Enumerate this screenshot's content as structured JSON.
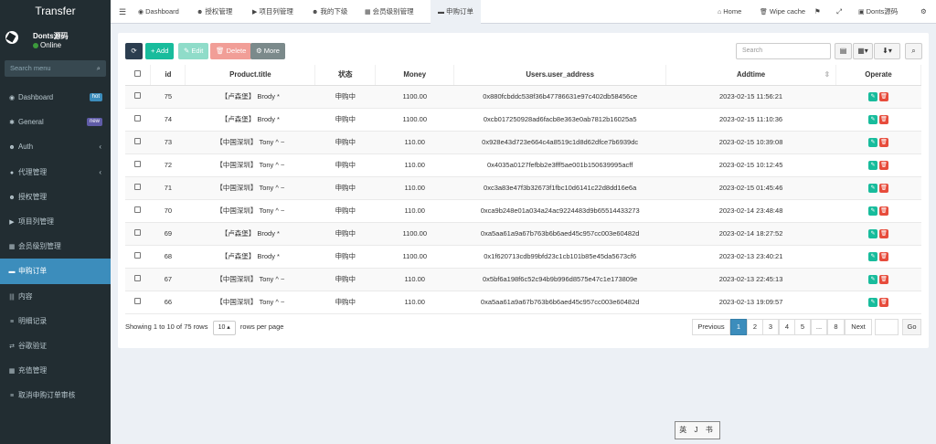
{
  "app": {
    "title": "Transfer"
  },
  "user": {
    "name": "Donts源码",
    "status": "Online"
  },
  "search": {
    "placeholder": "Search menu"
  },
  "menu": [
    {
      "icon": "dashboard-icon",
      "glyph": "◉",
      "label": "Dashboard",
      "badge": "hot",
      "badge_color": "#3c8dbc"
    },
    {
      "icon": "cogs-icon",
      "glyph": "✱",
      "label": "General",
      "badge": "new",
      "badge_color": "#605ca8"
    },
    {
      "icon": "users-icon",
      "glyph": "☻",
      "label": "Auth",
      "arrow": "‹"
    },
    {
      "icon": "user-circle-icon",
      "glyph": "●",
      "label": "代理管理",
      "arrow": "‹"
    },
    {
      "icon": "users-icon",
      "glyph": "☻",
      "label": "授权管理"
    },
    {
      "icon": "play-circle-icon",
      "glyph": "▶",
      "label": "项目列管理"
    },
    {
      "icon": "calendar-icon",
      "glyph": "▦",
      "label": "会员级别管理"
    },
    {
      "icon": "credit-card-icon",
      "glyph": "▬",
      "label": "申购订单",
      "active": true
    },
    {
      "icon": "barcode-icon",
      "glyph": "|||",
      "label": "内容"
    },
    {
      "icon": "list-icon",
      "glyph": "≡",
      "label": "明细记录"
    },
    {
      "icon": "exchange-icon",
      "glyph": "⇄",
      "label": "谷歌验证"
    },
    {
      "icon": "calendar-check-icon",
      "glyph": "▦",
      "label": "充值管理"
    },
    {
      "icon": "list-icon",
      "glyph": "≡",
      "label": "取消申购订单审核"
    }
  ],
  "topbar": {
    "menu_glyph": "☰",
    "tabs": [
      {
        "label": "Dashboard",
        "glyph": "◉"
      },
      {
        "label": "授权管理",
        "glyph": "☻"
      },
      {
        "label": "项目列管理",
        "glyph": "▶"
      },
      {
        "label": "我的下级",
        "glyph": "☻"
      },
      {
        "label": "会员级别管理",
        "glyph": "▦"
      },
      {
        "label": "申购订单",
        "glyph": "▬",
        "active": true
      }
    ],
    "home": "Home",
    "wipe": "Wipe cache",
    "user": "Donts源码"
  },
  "toolbar": {
    "refresh": "⟳",
    "add": "+ Add",
    "edit": "✎ Edit",
    "delete": "🗑 Delete",
    "more": "⚙ More",
    "search_placeholder": "Search"
  },
  "colors": {
    "primary": "#3c8dbc",
    "success": "#18bc9c",
    "danger": "#e74c3c",
    "edit_green": "#18bc9c",
    "more_gray": "#95a5a6",
    "dark": "#2c3e50"
  },
  "table": {
    "headers": [
      "id",
      "Product.title",
      "状态",
      "Money",
      "Users.user_address",
      "Addtime",
      "Operate"
    ],
    "rows": [
      {
        "id": "75",
        "title": "【卢森堡】 Brody *",
        "status": "申购中",
        "money": "1100.00",
        "address": "0x880fcbddc538f36b47786631e97c402db58456ce",
        "time": "2023-02-15 11:56:21"
      },
      {
        "id": "74",
        "title": "【卢森堡】 Brody *",
        "status": "申购中",
        "money": "1100.00",
        "address": "0xcb017250928ad6facb8e363e0ab7812b16025a5",
        "time": "2023-02-15 11:10:36"
      },
      {
        "id": "73",
        "title": "【中国深圳】 Tony ^ ~",
        "status": "申购中",
        "money": "110.00",
        "address": "0x928e43d723e664c4a8519c1d8d62dfce7b6939dc",
        "time": "2023-02-15 10:39:08"
      },
      {
        "id": "72",
        "title": "【中国深圳】 Tony ^ ~",
        "status": "申购中",
        "money": "110.00",
        "address": "0x4035a0127fefbb2e3fff5ae001b150639995acff",
        "time": "2023-02-15 10:12:45"
      },
      {
        "id": "71",
        "title": "【中国深圳】 Tony ^ ~",
        "status": "申购中",
        "money": "110.00",
        "address": "0xc3a83e47f3b32673f1fbc10d6141c22d8dd16e6a",
        "time": "2023-02-15 01:45:46"
      },
      {
        "id": "70",
        "title": "【中国深圳】 Tony ^ ~",
        "status": "申购中",
        "money": "110.00",
        "address": "0xca9b248e01a034a24ac9224483d9b65514433273",
        "time": "2023-02-14 23:48:48"
      },
      {
        "id": "69",
        "title": "【卢森堡】 Brody *",
        "status": "申购中",
        "money": "1100.00",
        "address": "0xa5aa61a9a67b763b6b6aed45c957cc003e60482d",
        "time": "2023-02-14 18:27:52"
      },
      {
        "id": "68",
        "title": "【卢森堡】 Brody *",
        "status": "申购中",
        "money": "1100.00",
        "address": "0x1f620713cdb99bfd23c1cb101b85e45da5673cf6",
        "time": "2023-02-13 23:40:21"
      },
      {
        "id": "67",
        "title": "【中国深圳】 Tony ^ ~",
        "status": "申购中",
        "money": "110.00",
        "address": "0x5bf6a198f6c52c94b9b996d8575e47c1e173809e",
        "time": "2023-02-13 22:45:13"
      },
      {
        "id": "66",
        "title": "【中国深圳】 Tony ^ ~",
        "status": "申购中",
        "money": "110.00",
        "address": "0xa5aa61a9a67b763b6b6aed45c957cc003e60482d",
        "time": "2023-02-13 19:09:57"
      }
    ]
  },
  "footer": {
    "showing": "Showing 1 to 10 of 75 rows",
    "page_size": "10 ▴",
    "rows_per_page": "rows per page"
  },
  "pagination": {
    "previous": "Previous",
    "pages": [
      "1",
      "2",
      "3",
      "4",
      "5",
      "...",
      "8"
    ],
    "next": "Next",
    "go": "Go",
    "jump_value": ""
  },
  "stamp": "英 J 书"
}
